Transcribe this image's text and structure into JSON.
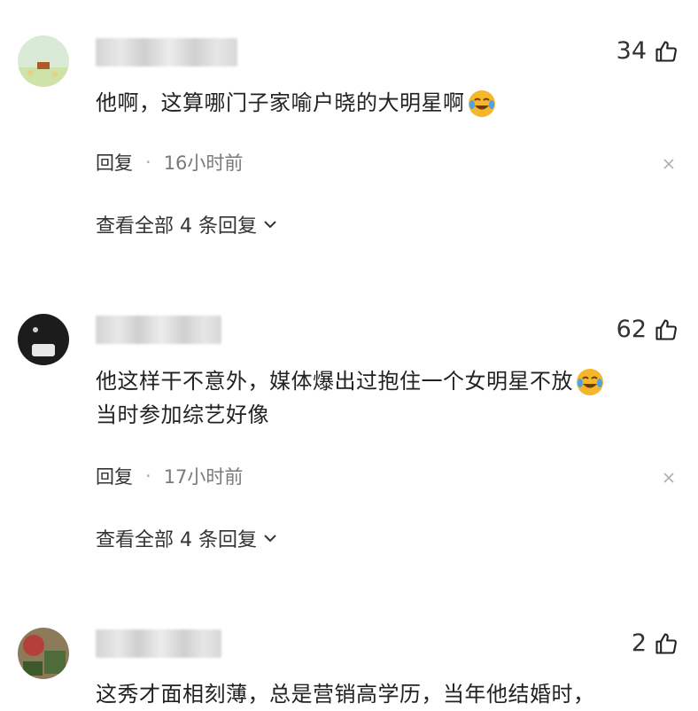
{
  "comments": [
    {
      "likes": "34",
      "text_lines": [
        "他啊，这算哪门子家喻户晓的大明星啊"
      ],
      "has_emoji": true,
      "reply_label": "回复",
      "time": "16小时前",
      "view_all": "查看全部 4 条回复"
    },
    {
      "likes": "62",
      "text_lines": [
        "他这样干不意外，媒体爆出过抱住一个女明星不放",
        "当时参加综艺好像"
      ],
      "has_emoji": true,
      "reply_label": "回复",
      "time": "17小时前",
      "view_all": "查看全部 4 条回复"
    },
    {
      "likes": "2",
      "text_lines": [
        "这秀才面相刻薄，总是营销高学历，当年他结婚时，"
      ],
      "has_emoji": false
    }
  ],
  "dot": "·",
  "icons": {
    "like": "thumbs-up-icon",
    "close": "close-icon",
    "expand": "chevron-down-icon",
    "emoji_laugh": "laughing-tears-emoji-icon"
  },
  "colors": {
    "text": "#222222",
    "meta": "#7a7a7a",
    "emoji": "#f5b62a"
  }
}
